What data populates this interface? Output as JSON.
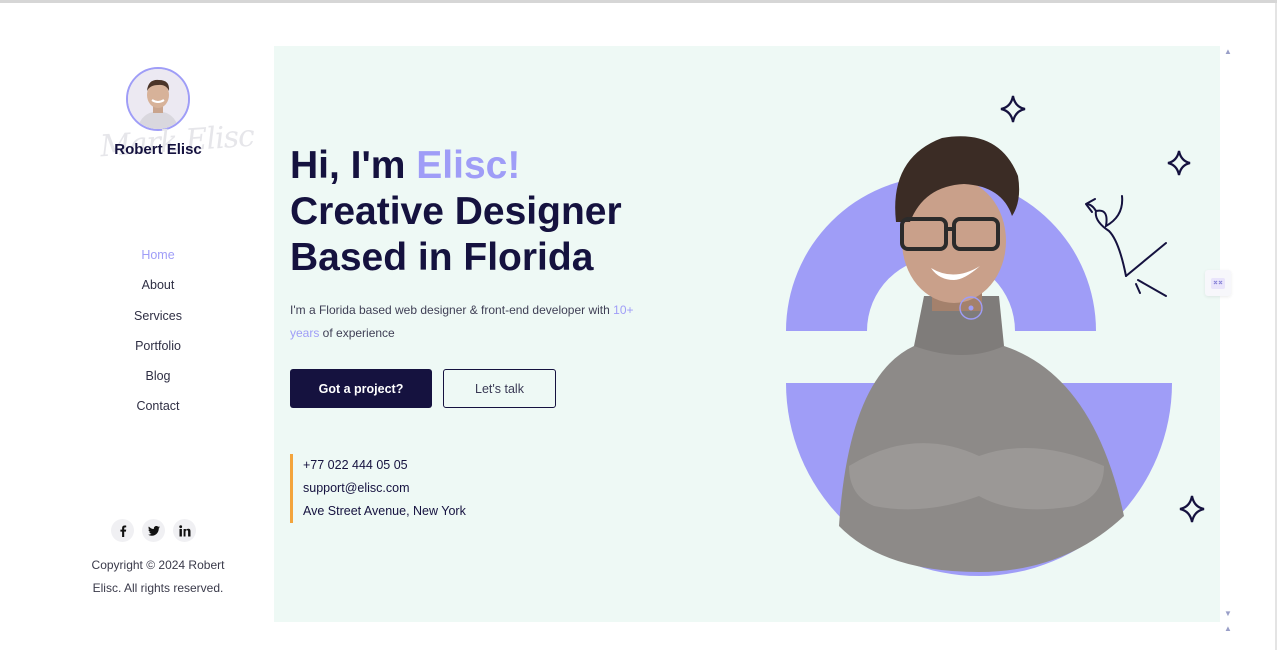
{
  "profile": {
    "name": "Robert Elisc",
    "signature": "Mark Elisc"
  },
  "nav": {
    "items": [
      "Home",
      "About",
      "Services",
      "Portfolio",
      "Blog",
      "Contact"
    ],
    "active": "Home"
  },
  "social": [
    {
      "icon": "facebook-icon",
      "glyph": "f"
    },
    {
      "icon": "twitter-icon",
      "glyph": "🐦"
    },
    {
      "icon": "linkedin-icon",
      "glyph": "in"
    }
  ],
  "copyright": "Copyright © 2024 Robert Elisc. All rights reserved.",
  "hero": {
    "greeting": "Hi, I'm ",
    "name_accent": "Elisc!",
    "line2": "Creative Designer",
    "line3": "Based in Florida",
    "desc_before": "I'm a Florida based web designer & front-end developer with ",
    "desc_accent": "10+ years",
    "desc_after": " of experience",
    "primary_button": "Got a project?",
    "secondary_button": "Let's talk"
  },
  "contact": {
    "phone": "+77 022 444 05 05",
    "email": "support@elisc.com",
    "address": "Ave Street Avenue, New York"
  },
  "colors": {
    "accent": "#9f9df7",
    "navy": "#15123f",
    "hero_bg": "#eef9f5",
    "contact_border": "#f3a43c"
  }
}
